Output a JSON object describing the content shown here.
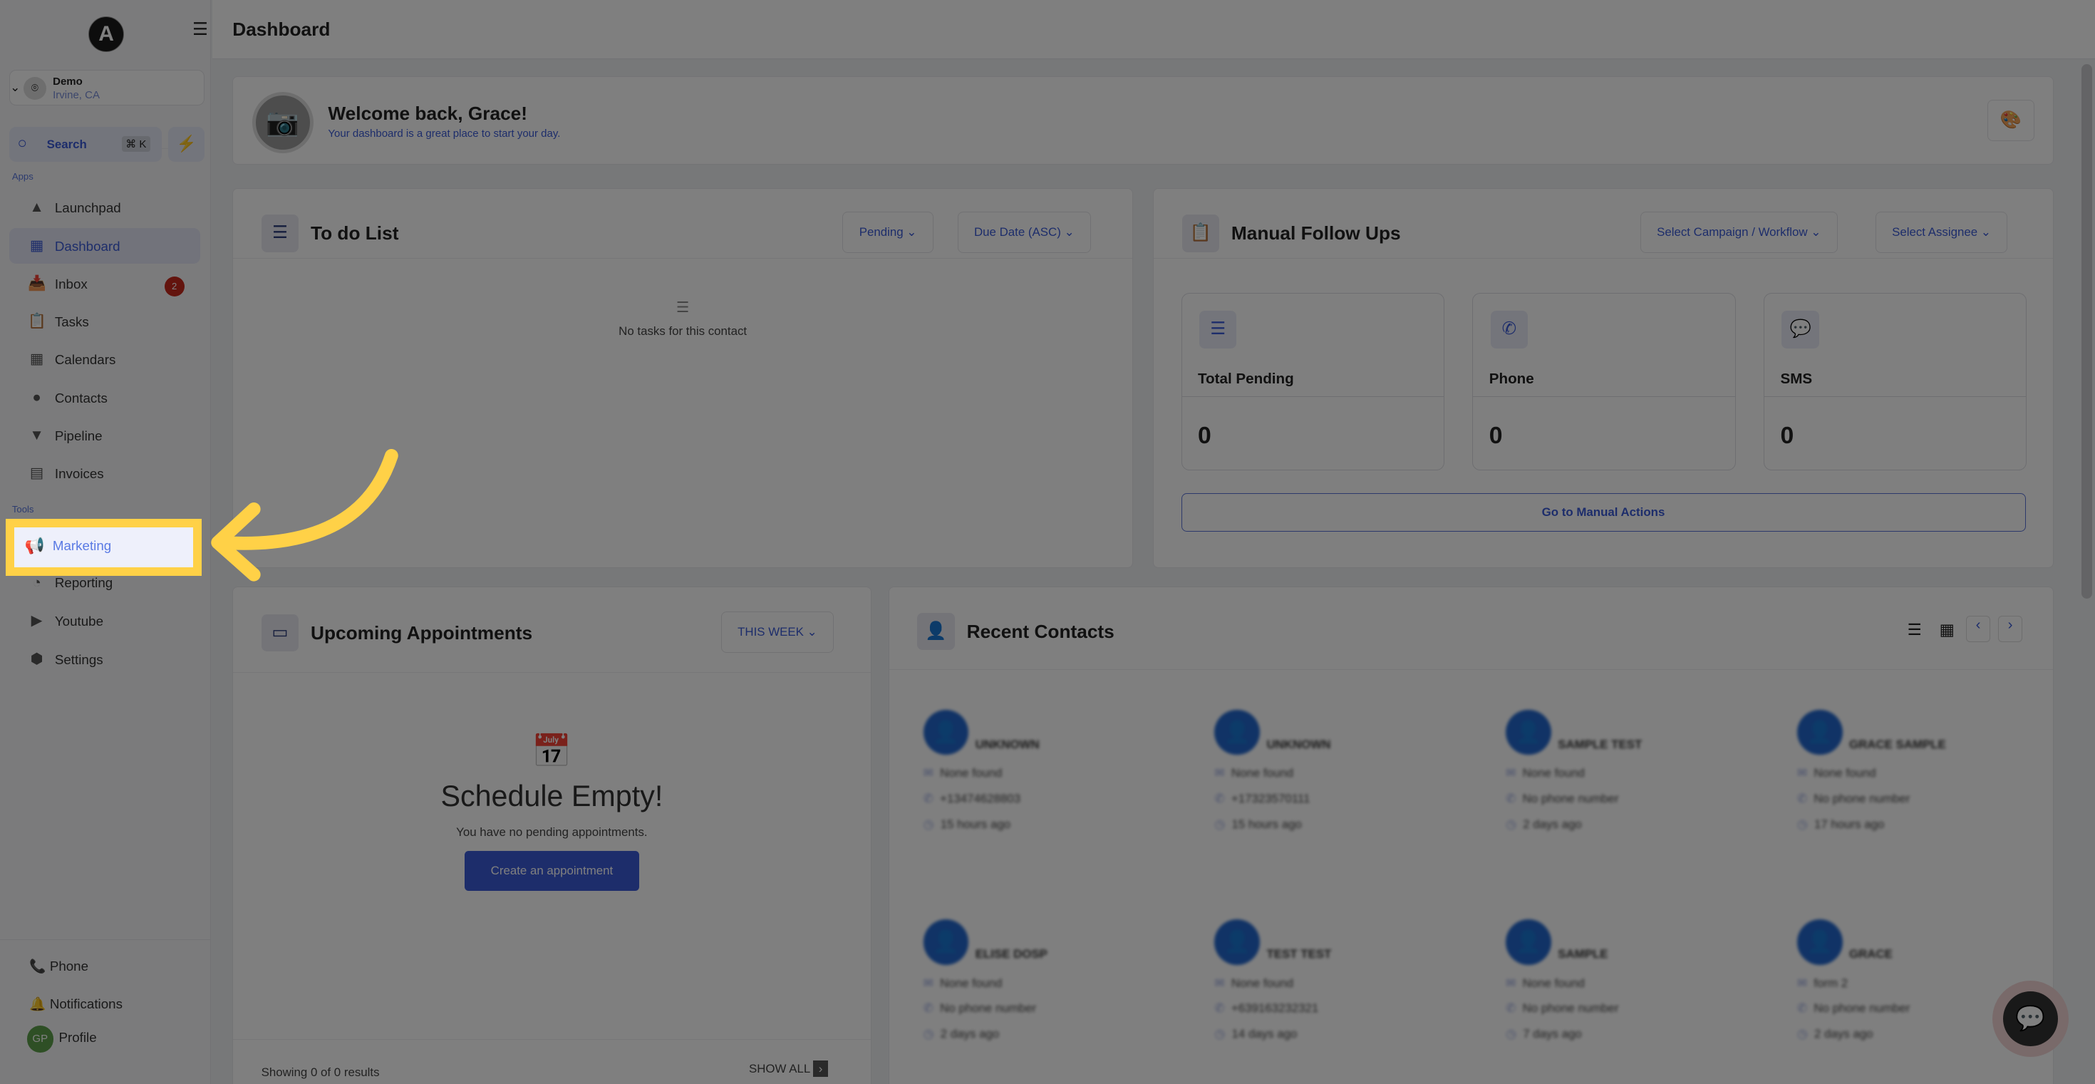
{
  "sidebar": {
    "logo": "A",
    "location": {
      "name": "Demo",
      "city": "Irvine, CA"
    },
    "search": {
      "label": "Search",
      "shortcut": "⌘ K"
    },
    "apps_label": "Apps",
    "tools_label": "Tools",
    "apps": [
      {
        "label": "Launchpad",
        "icon": "rocket-icon"
      },
      {
        "label": "Dashboard",
        "icon": "grid-icon",
        "active": true
      },
      {
        "label": "Inbox",
        "icon": "inbox-icon",
        "badge": "2"
      },
      {
        "label": "Tasks",
        "icon": "clipboard-icon"
      },
      {
        "label": "Calendars",
        "icon": "calendar-icon"
      },
      {
        "label": "Contacts",
        "icon": "user-icon"
      },
      {
        "label": "Pipeline",
        "icon": "funnel-icon"
      },
      {
        "label": "Invoices",
        "icon": "receipt-icon"
      }
    ],
    "tools": [
      {
        "label": "Marketing",
        "icon": "megaphone-icon",
        "highlighted": true
      },
      {
        "label": "Reporting",
        "icon": "pie-chart-icon"
      },
      {
        "label": "Youtube",
        "icon": "youtube-icon"
      },
      {
        "label": "Settings",
        "icon": "gear-icon"
      }
    ],
    "bottom": {
      "phone": "Phone",
      "notifications": "Notifications",
      "profile": "Profile",
      "avatar": "GP"
    }
  },
  "header": {
    "title": "Dashboard"
  },
  "welcome": {
    "title": "Welcome back, Grace!",
    "subtitle": "Your dashboard is a great place to start your day."
  },
  "todo": {
    "title": "To do List",
    "filter": "Pending",
    "sort": "Due Date (ASC)",
    "empty": "No tasks for this contact"
  },
  "follow_ups": {
    "title": "Manual Follow Ups",
    "campaign": "Select Campaign / Workflow",
    "assignee": "Select Assignee",
    "stats": [
      {
        "label": "Total Pending",
        "value": "0"
      },
      {
        "label": "Phone",
        "value": "0"
      },
      {
        "label": "SMS",
        "value": "0"
      }
    ],
    "action": "Go to Manual Actions"
  },
  "appointments": {
    "title": "Upcoming Appointments",
    "range": "THIS WEEK",
    "empty_title": "Schedule Empty!",
    "empty_text": "You have no pending appointments.",
    "create": "Create an appointment",
    "results": "Showing 0 of 0 results",
    "show_all": "SHOW ALL"
  },
  "contacts": {
    "title": "Recent Contacts",
    "items": [
      {
        "name": "UNKNOWN",
        "email": "None found",
        "phone": "+13474628803",
        "time": "15 hours ago"
      },
      {
        "name": "UNKNOWN",
        "email": "None found",
        "phone": "+17323570111",
        "time": "15 hours ago"
      },
      {
        "name": "SAMPLE TEST",
        "email": "None found",
        "phone": "No phone number",
        "time": "2 days ago"
      },
      {
        "name": "GRACE SAMPLE",
        "email": "None found",
        "phone": "No phone number",
        "time": "17 hours ago"
      },
      {
        "name": "ELISE DOSP",
        "email": "None found",
        "phone": "No phone number",
        "time": "2 days ago"
      },
      {
        "name": "TEST TEST",
        "email": "None found",
        "phone": "+639163232321",
        "time": "14 days ago"
      },
      {
        "name": "SAMPLE",
        "email": "None found",
        "phone": "No phone number",
        "time": "7 days ago"
      },
      {
        "name": "GRACE",
        "email": "form 2",
        "phone": "No phone number",
        "time": "2 days ago"
      }
    ]
  },
  "colors": {
    "accent": "#3b5bd6",
    "highlight": "#ffd147",
    "badge": "#c6281c"
  }
}
